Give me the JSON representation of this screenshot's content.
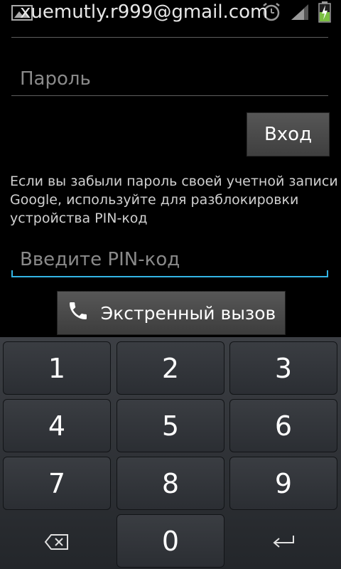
{
  "status_bar": {
    "left_icon": "image-icon",
    "right_icons": [
      "alarm-icon",
      "signal-icon",
      "battery-charging-icon"
    ]
  },
  "login": {
    "email_value": "xuemutly.r999@gmail.com",
    "password_placeholder": "Пароль",
    "login_button_label": "Вход",
    "help_text": "Если вы забыли пароль своей учетной записи Google, используйте для разблокировки устройства PIN-код",
    "pin_placeholder": "Введите PIN-код"
  },
  "emergency": {
    "label": "Экстренный вызов",
    "icon": "phone-icon"
  },
  "keypad": {
    "keys": [
      "1",
      "2",
      "3",
      "4",
      "5",
      "6",
      "7",
      "8",
      "9",
      "0"
    ],
    "delete_icon": "backspace-icon",
    "enter_icon": "enter-icon"
  },
  "colors": {
    "accent": "#33b5e5",
    "background": "#000000",
    "keypad_bg": "#2b2e33"
  }
}
